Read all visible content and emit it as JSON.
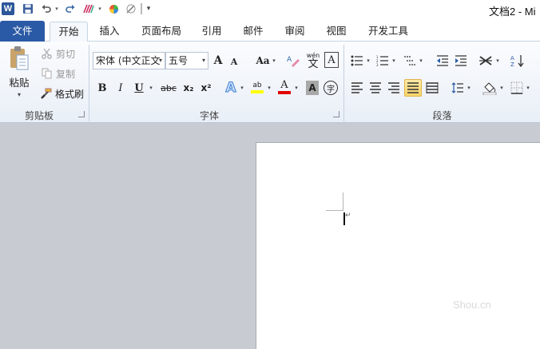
{
  "title": "文档2 - Mi",
  "qat": {
    "word_logo": "W",
    "icons": [
      "save-icon",
      "undo-icon",
      "redo-icon",
      "format-painter-icon",
      "color-wheel-icon",
      "pen-icon"
    ]
  },
  "tabs": [
    {
      "label": "文件"
    },
    {
      "label": "开始"
    },
    {
      "label": "插入"
    },
    {
      "label": "页面布局"
    },
    {
      "label": "引用"
    },
    {
      "label": "邮件"
    },
    {
      "label": "审阅"
    },
    {
      "label": "视图"
    },
    {
      "label": "开发工具"
    }
  ],
  "clipboard": {
    "paste": "粘贴",
    "cut": "剪切",
    "copy": "复制",
    "format_painter": "格式刷",
    "label": "剪贴板"
  },
  "font": {
    "font_name": "宋体 (中文正文",
    "font_size": "五号",
    "grow": "A",
    "shrink": "A",
    "case": "Aa",
    "phonetic": "wén",
    "phonetic_char": "文",
    "border_char": "A",
    "bold": "B",
    "italic": "I",
    "underline": "U",
    "strike": "abc",
    "subscript": "x₂",
    "superscript": "x²",
    "effects": "A",
    "highlight": "ab",
    "font_color": "A",
    "shading": "A",
    "enclose": "字",
    "label": "字体"
  },
  "paragraph": {
    "label": "段落"
  },
  "colors": {
    "file_tab": "#2a5aa5",
    "highlight": "#ffff00",
    "font_color": "#e00000",
    "selected": "#f9d56a"
  },
  "watermark": "Shou.cn"
}
